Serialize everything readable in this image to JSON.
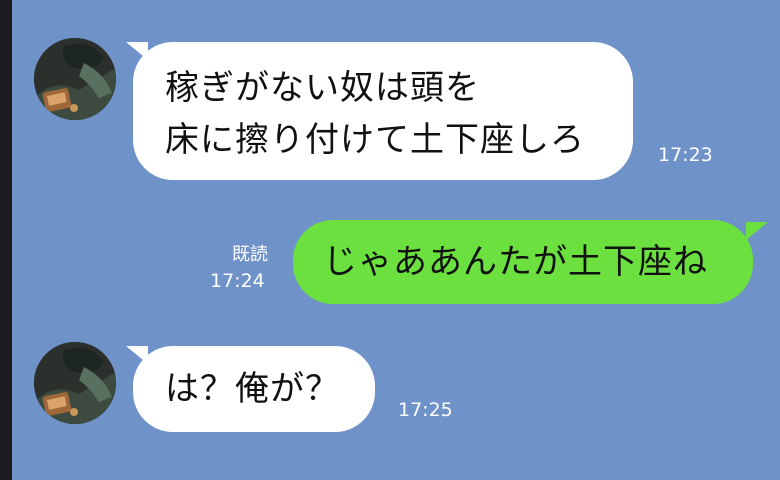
{
  "chat": {
    "messages": [
      {
        "direction": "incoming",
        "lines": [
          "稼ぎがない奴は頭を",
          "床に擦り付けて土下座しろ"
        ],
        "time": "17:23"
      },
      {
        "direction": "outgoing",
        "lines": [
          "じゃああんたが土下座ね"
        ],
        "read_label": "既読",
        "time": "17:24"
      },
      {
        "direction": "incoming",
        "lines": [
          "は？俺が？"
        ],
        "time": "17:25"
      }
    ],
    "colors": {
      "background": "#6f93c9",
      "incoming_bubble": "#ffffff",
      "outgoing_bubble": "#6be03e"
    },
    "avatar_icon": "profile-photo-icon"
  }
}
